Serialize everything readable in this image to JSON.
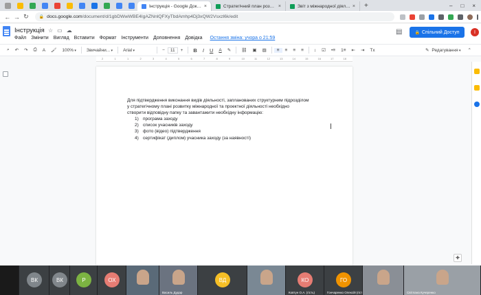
{
  "browser": {
    "tabs": [
      {
        "label": "Інструкція - Google Документи",
        "color": "#4285f4",
        "active": true
      },
      {
        "label": "Стратегічний план розвитку м...",
        "color": "#0f9d58",
        "active": false
      },
      {
        "label": "Звіт з міжнародної діяльності",
        "color": "#0f9d58",
        "active": false
      }
    ],
    "url_domain": "docs.google.com",
    "url_path": "/document/d/1gbDWwWBE4IgAZNnlQFXyTbdAmhp4Dj3xQW2Vsxzl6k/edit"
  },
  "doc": {
    "title": "Інструкція",
    "menu": [
      "Файл",
      "Змінити",
      "Вигляд",
      "Вставити",
      "Формат",
      "Інструменти",
      "Доповнення",
      "Довідка"
    ],
    "last_edit": "Остання зміна: учора о 21:59",
    "share_label": "Спільний Доступ",
    "user_initial": "I"
  },
  "toolbar": {
    "zoom": "100%",
    "style": "Звичайни...",
    "font": "Arial",
    "size": "11",
    "mode": "Редагування"
  },
  "ruler": [
    "2",
    "1",
    "1",
    "2",
    "3",
    "4",
    "5",
    "6",
    "7",
    "8",
    "9",
    "10",
    "11",
    "12",
    "13",
    "14",
    "15",
    "16",
    "17",
    "18"
  ],
  "body": {
    "paragraph": [
      "Для підтвердження виконання видів діяльності, запланованих структурним підрозділом",
      "у стратегічному плані розвитку міжнародної та проектної діяльності необхідно",
      "створити відповідну папку та завантажити необхідну  інформацію:"
    ],
    "list": [
      {
        "n": "1)",
        "text": "програма заходу"
      },
      {
        "n": "2)",
        "text": "список учасників заходу"
      },
      {
        "n": "3)",
        "text": "фото (відео) підтвердження"
      },
      {
        "n": "4)",
        "text": "сертифікат (диплом) учасника заходу (за наявності)"
      }
    ]
  },
  "meet": {
    "tiles": [
      {
        "initials": "",
        "name": "",
        "bg": "#1a1a1a"
      },
      {
        "initials": "ВК",
        "name": "",
        "bg": "#80868b"
      },
      {
        "initials": "ВК",
        "name": "",
        "bg": "#80868b"
      },
      {
        "initials": "Р",
        "name": "",
        "bg": "#7cb342"
      },
      {
        "initials": "ОХ",
        "name": "",
        "bg": "#e67c73"
      },
      {
        "initials": "",
        "name": "",
        "bg": "#5a6a78",
        "video": true
      },
      {
        "initials": "",
        "name": "Василь Дудар",
        "bg": "#6b7380",
        "video": true
      },
      {
        "initials": "ВД",
        "name": "",
        "bg": "#f6bf26"
      },
      {
        "initials": "",
        "name": "",
        "bg": "#7a8894",
        "video": true
      },
      {
        "initials": "КО",
        "name": "Ковтун О.А. (гість)",
        "bg": "#e67c73"
      },
      {
        "initials": "ГО",
        "name": "Гончаренко Олексій (гість)",
        "bg": "#f09300"
      },
      {
        "initials": "",
        "name": "",
        "bg": "#8a8f96",
        "video": true
      },
      {
        "initials": "",
        "name": "Світлана Кучеренко",
        "bg": "#9aa0a6",
        "video": true
      }
    ]
  }
}
